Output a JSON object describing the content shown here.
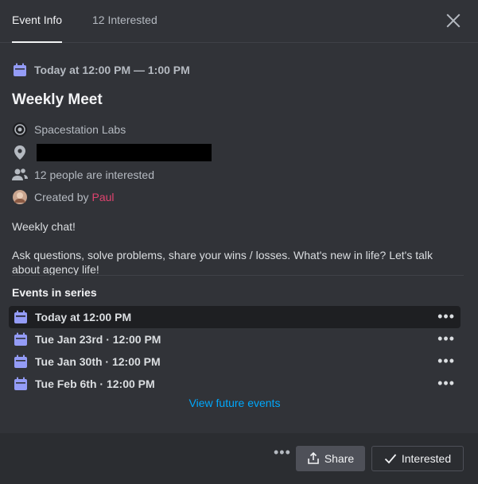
{
  "tabs": [
    {
      "label": "Event Info",
      "active": true
    },
    {
      "label": "12 Interested",
      "active": false
    }
  ],
  "event": {
    "time": "Today at 12:00 PM — 1:00 PM",
    "title": "Weekly Meet",
    "server": "Spacestation Labs",
    "interested_text": "12 people are interested",
    "created_by_label": "Created by",
    "creator": "Paul",
    "description_line1": "Weekly chat!",
    "description_line2": "Ask questions, solve problems, share your wins / losses. What's new in life? Let's talk about agency life!"
  },
  "series": {
    "heading": "Events in series",
    "items": [
      {
        "label": "Today at 12:00 PM",
        "active": true
      },
      {
        "label": "Tue Jan 23rd · 12:00 PM",
        "active": false
      },
      {
        "label": "Tue Jan 30th · 12:00 PM",
        "active": false
      },
      {
        "label": "Tue Feb 6th · 12:00 PM",
        "active": false
      }
    ],
    "more_dots": "•••",
    "view_future": "View future events"
  },
  "footer": {
    "more_dots": "•••",
    "share": "Share",
    "interested": "Interested"
  },
  "colors": {
    "background": "#313338",
    "footer": "#2b2d31",
    "calendar_icon": "#949cf7",
    "link": "#00a8fc",
    "creator": "#e0436f"
  }
}
